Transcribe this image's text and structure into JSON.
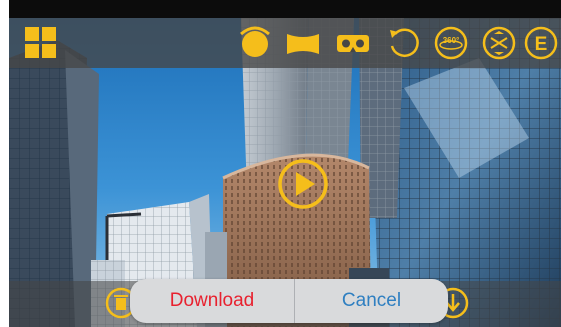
{
  "colors": {
    "accent": "#f5be1b",
    "toolbar_bg": "#464646",
    "dialog_bg": "#d9dadc",
    "download_text": "#e8212f",
    "cancel_text": "#2f7fc1"
  },
  "toolbar": {
    "menu_icon": "grid-icon",
    "view_modes": [
      {
        "icon": "little-planet-icon"
      },
      {
        "icon": "panorama-icon"
      },
      {
        "icon": "vr-goggles-icon"
      },
      {
        "icon": "rotate-icon"
      },
      {
        "icon": "view-360-icon",
        "text": "360°"
      },
      {
        "icon": "tilt-icon"
      },
      {
        "icon": "e-mode-icon",
        "text": "E"
      }
    ]
  },
  "player": {
    "play_icon": "play-icon"
  },
  "bottom_bar": {
    "left_icon": "trash-icon",
    "right_icon": "download-arrow-icon"
  },
  "dialog": {
    "download_label": "Download",
    "cancel_label": "Cancel"
  }
}
